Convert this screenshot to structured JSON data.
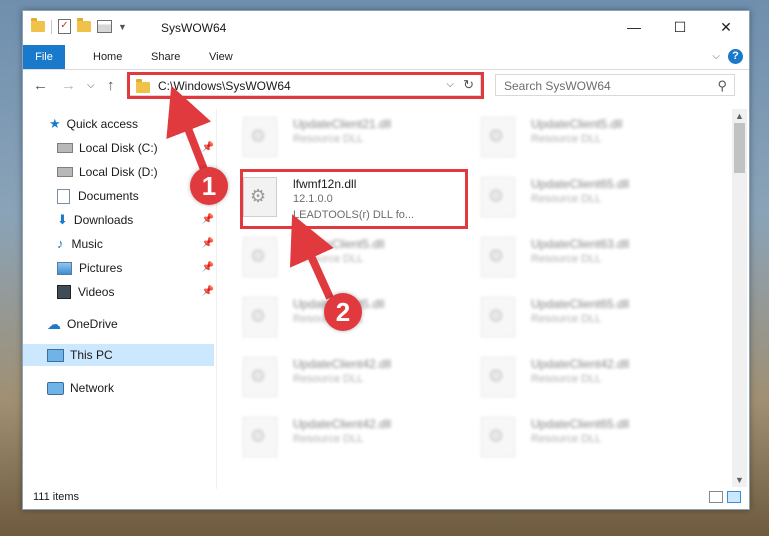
{
  "window": {
    "title": "SysWOW64"
  },
  "ribbon": {
    "tabs": [
      "File",
      "Home",
      "Share",
      "View"
    ]
  },
  "address": {
    "path": "C:\\Windows\\SysWOW64"
  },
  "search": {
    "placeholder": "Search SysWOW64"
  },
  "nav": {
    "quick_access": "Quick access",
    "items": [
      "Local Disk (C:)",
      "Local Disk (D:)",
      "Documents",
      "Downloads",
      "Music",
      "Pictures",
      "Videos"
    ],
    "onedrive": "OneDrive",
    "this_pc": "This PC",
    "network": "Network"
  },
  "files": {
    "highlighted": {
      "name": "lfwmf12n.dll",
      "version": "12.1.0.0",
      "description": "LEADTOOLS(r) DLL fo..."
    },
    "background": [
      {
        "name": "UpdateClient21.dll",
        "type": "Resource DLL"
      },
      {
        "name": "UpdateClient5.dll",
        "type": "Resource DLL"
      },
      {
        "name": "UpdateClient65.dll",
        "type": "Resource DLL"
      },
      {
        "name": "UpdateClient5.dll",
        "type": "Resource DLL"
      },
      {
        "name": "UpdateClient63.dll",
        "type": "Resource DLL"
      },
      {
        "name": "UpdateClient5.dll",
        "type": "Resource DLL"
      },
      {
        "name": "UpdateClient65.dll",
        "type": "Resource DLL"
      },
      {
        "name": "UpdateClient42.dll",
        "type": "Resource DLL"
      },
      {
        "name": "UpdateClient42.dll",
        "type": "Resource DLL"
      },
      {
        "name": "UpdateClient42.dll",
        "type": "Resource DLL"
      },
      {
        "name": "UpdateClient65.dll",
        "type": "Resource DLL"
      }
    ]
  },
  "status": {
    "count": "111 items"
  },
  "annotations": {
    "step1": "1",
    "step2": "2",
    "color": "#e0393e"
  },
  "icons": [
    "folder-icon",
    "checkmark-icon",
    "properties-icon",
    "refresh-icon",
    "search-icon",
    "pin-icon",
    "gear-icon"
  ]
}
